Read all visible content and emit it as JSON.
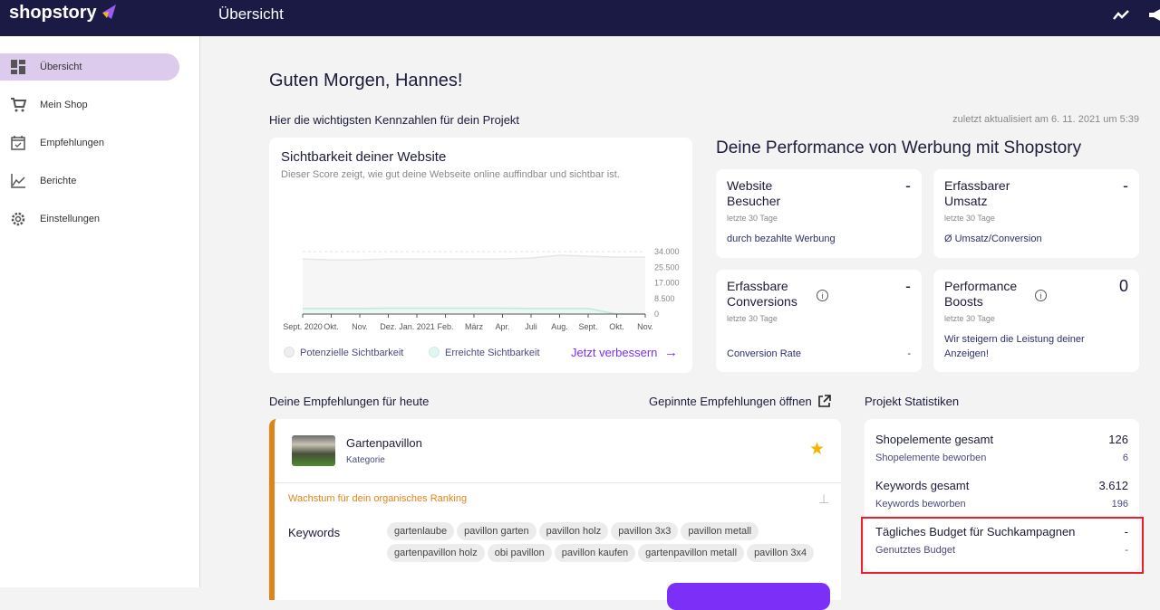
{
  "header": {
    "brand": "shopstory",
    "title": "Übersicht",
    "icons": [
      "trend-icon",
      "megaphone-icon"
    ]
  },
  "sidebar": {
    "items": [
      {
        "label": "Übersicht",
        "icon": "dashboard-icon",
        "active": true
      },
      {
        "label": "Mein Shop",
        "icon": "cart-icon"
      },
      {
        "label": "Empfehlungen",
        "icon": "calendar-check-icon"
      },
      {
        "label": "Berichte",
        "icon": "chart-line-icon"
      },
      {
        "label": "Einstellungen",
        "icon": "gear-icon"
      }
    ]
  },
  "main": {
    "greeting": "Guten Morgen, Hannes!",
    "subtitle": "Hier die wichtigsten Kennzahlen für dein Projekt",
    "updated": "zuletzt aktualisiert am 6. 11. 2021 um 5:39",
    "visibility": {
      "title": "Sichtbarkeit deiner Website",
      "description": "Dieser Score zeigt, wie gut deine Webseite online auffindbar und sichtbar ist.",
      "legend": [
        "Potenzielle Sichtbarkeit",
        "Erreichte Sichtbarkeit"
      ],
      "cta": "Jetzt verbessern"
    },
    "performance": {
      "title": "Deine Performance von Werbung mit Shopstory",
      "cards": [
        {
          "title": "Website Besucher",
          "value": "-",
          "period": "letzte 30 Tage",
          "desc": "durch bezahlte Werbung"
        },
        {
          "title": "Erfassbarer Umsatz",
          "value": "-",
          "period": "letzte 30 Tage",
          "desc": "Ø Umsatz/Conversion"
        },
        {
          "title": "Erfassbare Conversions",
          "value": "-",
          "period": "letzte 30 Tage",
          "desc": "Conversion Rate",
          "desc_value": "-"
        },
        {
          "title": "Performance Boosts",
          "value": "0",
          "period": "letzte 30 Tage",
          "desc": "Wir steigern die Leistung deiner Anzeigen!"
        }
      ]
    },
    "recommendations": {
      "title": "Deine Empfehlungen für heute",
      "pinned_link": "Gepinnte Empfehlungen öffnen",
      "item": {
        "name": "Gartenpavillon",
        "type": "Kategorie",
        "reason": "Wachstum für dein organisches Ranking",
        "keywords_label": "Keywords",
        "keywords": [
          "gartenlaube",
          "pavillon garten",
          "pavillon holz",
          "pavillon 3x3",
          "pavillon metall",
          "gartenpavillon holz",
          "obi pavillon",
          "pavillon kaufen",
          "gartenpavillon metall",
          "pavillon 3x4"
        ]
      }
    },
    "stats": {
      "title": "Projekt Statistiken",
      "rows": [
        {
          "label": "Shopelemente gesamt",
          "value": "126",
          "sub_label": "Shopelemente beworben",
          "sub_value": "6"
        },
        {
          "label": "Keywords gesamt",
          "value": "3.612",
          "sub_label": "Keywords beworben",
          "sub_value": "196"
        },
        {
          "label": "Tägliches Budget für Suchkampagnen",
          "value": "-",
          "sub_label": "Genutztes Budget",
          "sub_value": "-"
        }
      ]
    }
  },
  "chart_data": {
    "type": "area",
    "categories": [
      "Sept. 2020",
      "Okt.",
      "Nov.",
      "Dez.",
      "Jan. 2021",
      "Feb.",
      "März",
      "Apr.",
      "Juli",
      "Aug.",
      "Sept.",
      "Okt.",
      "Nov."
    ],
    "series": [
      {
        "name": "Potenzielle Sichtbarkeit",
        "values": [
          30000,
          29500,
          29500,
          30000,
          30000,
          30000,
          30000,
          30000,
          30500,
          32000,
          31500,
          31000,
          31000
        ],
        "color": "#e6e6e6"
      },
      {
        "name": "Erreichte Sichtbarkeit",
        "values": [
          3000,
          3000,
          3000,
          3200,
          3200,
          3200,
          3200,
          3200,
          3000,
          3000,
          3000,
          0,
          0
        ],
        "color": "#bfe8de"
      }
    ],
    "yticks": [
      "34.000",
      "25.500",
      "17.000",
      "8.500",
      "0"
    ],
    "ylim": [
      0,
      34000
    ],
    "grid": true
  }
}
